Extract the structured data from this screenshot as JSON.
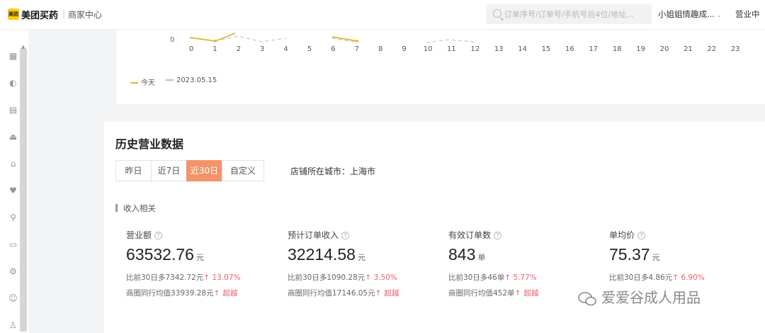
{
  "header": {
    "logo_badge": "美团",
    "brand": "美团买药",
    "separator": "|",
    "sub_title": "商家中心",
    "search_placeholder": "订单序号/订单号/手机号后4位/地址...",
    "account_name": "小姐姐情趣成...",
    "status_label": "营业中"
  },
  "sidebar": {
    "icons": [
      "grid-icon",
      "pie-chart-icon",
      "list-icon",
      "cloud-upload-icon",
      "gift-icon",
      "heart-icon",
      "bike-icon",
      "store-icon",
      "settings-icon",
      "user-icon",
      "person-icon"
    ]
  },
  "chart": {
    "ytick": "0",
    "xticks": [
      "0",
      "1",
      "2",
      "3",
      "4",
      "5",
      "6",
      "7",
      "8",
      "9",
      "10",
      "11",
      "12",
      "13",
      "14",
      "15",
      "16",
      "17",
      "18",
      "19",
      "20",
      "21",
      "22",
      "23"
    ],
    "legend": [
      {
        "label": "今天",
        "color": "#e8b93a",
        "style": "solid"
      },
      {
        "label": "2023.05.15",
        "color": "#b8bcc4",
        "style": "dashed"
      }
    ]
  },
  "history": {
    "title": "历史营业数据",
    "tabs": [
      {
        "label": "昨日",
        "active": false
      },
      {
        "label": "近7日",
        "active": false
      },
      {
        "label": "近30日",
        "active": true
      },
      {
        "label": "自定义",
        "active": false
      }
    ],
    "city_label": "店铺所在城市：上海市",
    "sub_heading": "收入相关",
    "metrics": [
      {
        "title": "营业额",
        "value": "63532.76",
        "unit": "元",
        "compare_text": "比前30日多7342.72元",
        "compare_arrow": "↑",
        "compare_pct": "13.07%",
        "peer_text": "商圈同行均值33939.28元",
        "peer_arrow": "↑",
        "peer_badge": "超越"
      },
      {
        "title": "预计订单收入",
        "value": "32214.58",
        "unit": "元",
        "compare_text": "比前30日多1090.28元",
        "compare_arrow": "↑",
        "compare_pct": "3.50%",
        "peer_text": "商圈同行均值17146.05元",
        "peer_arrow": "↑",
        "peer_badge": "超越"
      },
      {
        "title": "有效订单数",
        "value": "843",
        "unit": "单",
        "compare_text": "比前30日多46单",
        "compare_arrow": "↑",
        "compare_pct": "5.77%",
        "peer_text": "商圈同行均值452单",
        "peer_arrow": "↑",
        "peer_badge": "超越"
      },
      {
        "title": "单均价",
        "value": "75.37",
        "unit": "元",
        "compare_text": "比前30日多4.86元",
        "compare_arrow": "↑",
        "compare_pct": "6.90%",
        "peer_text": "",
        "peer_arrow": "",
        "peer_badge": ""
      }
    ]
  },
  "watermark": {
    "text": "爱爱谷成人用品"
  }
}
